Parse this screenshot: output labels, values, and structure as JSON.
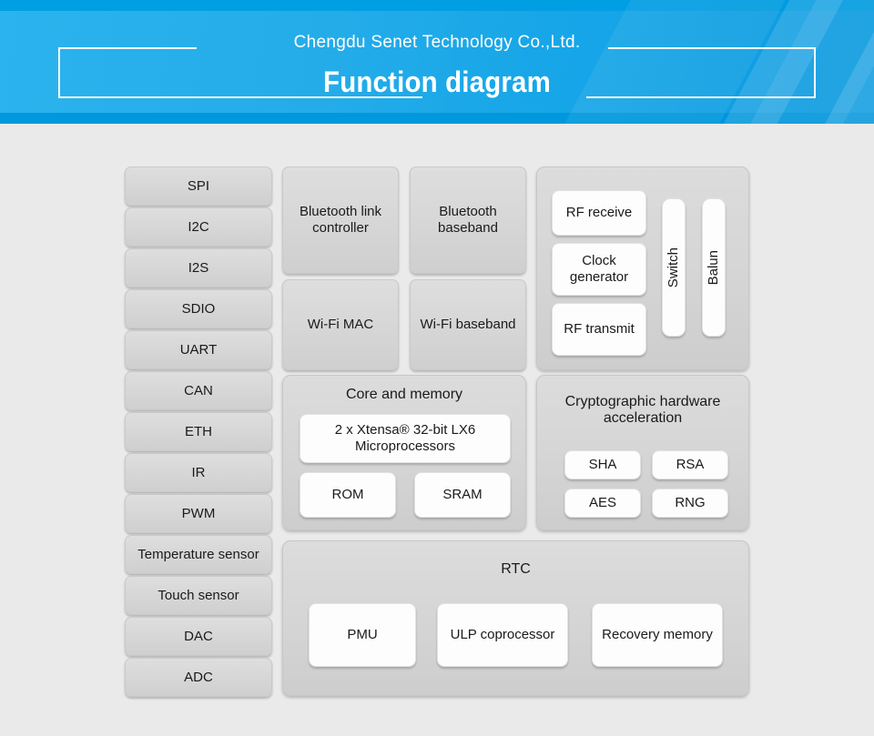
{
  "banner": {
    "company_name": "Chengdu Senet Technology Co.,Ltd.",
    "title": "Function diagram",
    "accent_color": "#23ace9",
    "accent_dark": "#009fe3",
    "frame_color": "#ffffff"
  },
  "diagram": {
    "background_color": "#eaeaea",
    "block_color": "#d6d6d6",
    "inner_block_color": "#fdfdfd",
    "peripherals": [
      {
        "label": "SPI"
      },
      {
        "label": "I2C"
      },
      {
        "label": "I2S"
      },
      {
        "label": "SDIO"
      },
      {
        "label": "UART"
      },
      {
        "label": "CAN"
      },
      {
        "label": "ETH"
      },
      {
        "label": "IR"
      },
      {
        "label": "PWM"
      },
      {
        "label": "Temperature sensor"
      },
      {
        "label": "Touch sensor"
      },
      {
        "label": "DAC"
      },
      {
        "label": "ADC"
      }
    ],
    "radio_blocks": [
      {
        "label": "Bluetooth link controller"
      },
      {
        "label": "Bluetooth baseband"
      },
      {
        "label": "Wi-Fi MAC"
      },
      {
        "label": "Wi-Fi baseband"
      }
    ],
    "rf_group": {
      "blocks": [
        {
          "label": "RF receive"
        },
        {
          "label": "Clock generator"
        },
        {
          "label": "RF transmit"
        }
      ],
      "vertical_blocks": [
        {
          "label": "Switch"
        },
        {
          "label": "Balun"
        }
      ]
    },
    "core_group": {
      "title": "Core and memory",
      "blocks": [
        {
          "label": "2 x Xtensa® 32-bit LX6 Microprocessors"
        },
        {
          "label": "ROM"
        },
        {
          "label": "SRAM"
        }
      ]
    },
    "crypto_group": {
      "title": "Cryptographic hardware acceleration",
      "blocks": [
        {
          "label": "SHA"
        },
        {
          "label": "RSA"
        },
        {
          "label": "AES"
        },
        {
          "label": "RNG"
        }
      ]
    },
    "rtc_group": {
      "title": "RTC",
      "blocks": [
        {
          "label": "PMU"
        },
        {
          "label": "ULP coprocessor"
        },
        {
          "label": "Recovery memory"
        }
      ]
    }
  }
}
